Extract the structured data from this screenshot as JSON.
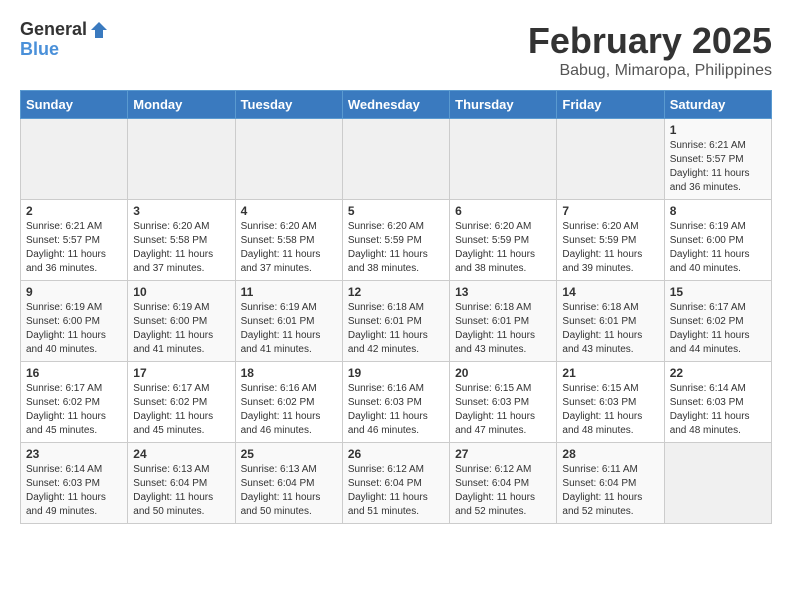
{
  "logo": {
    "general": "General",
    "blue": "Blue"
  },
  "title": "February 2025",
  "subtitle": "Babug, Mimaropa, Philippines",
  "days_of_week": [
    "Sunday",
    "Monday",
    "Tuesday",
    "Wednesday",
    "Thursday",
    "Friday",
    "Saturday"
  ],
  "weeks": [
    [
      {
        "day": "",
        "sunrise": "",
        "sunset": "",
        "daylight": ""
      },
      {
        "day": "",
        "sunrise": "",
        "sunset": "",
        "daylight": ""
      },
      {
        "day": "",
        "sunrise": "",
        "sunset": "",
        "daylight": ""
      },
      {
        "day": "",
        "sunrise": "",
        "sunset": "",
        "daylight": ""
      },
      {
        "day": "",
        "sunrise": "",
        "sunset": "",
        "daylight": ""
      },
      {
        "day": "",
        "sunrise": "",
        "sunset": "",
        "daylight": ""
      },
      {
        "day": "1",
        "sunrise": "Sunrise: 6:21 AM",
        "sunset": "Sunset: 5:57 PM",
        "daylight": "Daylight: 11 hours and 36 minutes."
      }
    ],
    [
      {
        "day": "2",
        "sunrise": "Sunrise: 6:21 AM",
        "sunset": "Sunset: 5:57 PM",
        "daylight": "Daylight: 11 hours and 36 minutes."
      },
      {
        "day": "3",
        "sunrise": "Sunrise: 6:20 AM",
        "sunset": "Sunset: 5:58 PM",
        "daylight": "Daylight: 11 hours and 37 minutes."
      },
      {
        "day": "4",
        "sunrise": "Sunrise: 6:20 AM",
        "sunset": "Sunset: 5:58 PM",
        "daylight": "Daylight: 11 hours and 37 minutes."
      },
      {
        "day": "5",
        "sunrise": "Sunrise: 6:20 AM",
        "sunset": "Sunset: 5:59 PM",
        "daylight": "Daylight: 11 hours and 38 minutes."
      },
      {
        "day": "6",
        "sunrise": "Sunrise: 6:20 AM",
        "sunset": "Sunset: 5:59 PM",
        "daylight": "Daylight: 11 hours and 38 minutes."
      },
      {
        "day": "7",
        "sunrise": "Sunrise: 6:20 AM",
        "sunset": "Sunset: 5:59 PM",
        "daylight": "Daylight: 11 hours and 39 minutes."
      },
      {
        "day": "8",
        "sunrise": "Sunrise: 6:19 AM",
        "sunset": "Sunset: 6:00 PM",
        "daylight": "Daylight: 11 hours and 40 minutes."
      }
    ],
    [
      {
        "day": "9",
        "sunrise": "Sunrise: 6:19 AM",
        "sunset": "Sunset: 6:00 PM",
        "daylight": "Daylight: 11 hours and 40 minutes."
      },
      {
        "day": "10",
        "sunrise": "Sunrise: 6:19 AM",
        "sunset": "Sunset: 6:00 PM",
        "daylight": "Daylight: 11 hours and 41 minutes."
      },
      {
        "day": "11",
        "sunrise": "Sunrise: 6:19 AM",
        "sunset": "Sunset: 6:01 PM",
        "daylight": "Daylight: 11 hours and 41 minutes."
      },
      {
        "day": "12",
        "sunrise": "Sunrise: 6:18 AM",
        "sunset": "Sunset: 6:01 PM",
        "daylight": "Daylight: 11 hours and 42 minutes."
      },
      {
        "day": "13",
        "sunrise": "Sunrise: 6:18 AM",
        "sunset": "Sunset: 6:01 PM",
        "daylight": "Daylight: 11 hours and 43 minutes."
      },
      {
        "day": "14",
        "sunrise": "Sunrise: 6:18 AM",
        "sunset": "Sunset: 6:01 PM",
        "daylight": "Daylight: 11 hours and 43 minutes."
      },
      {
        "day": "15",
        "sunrise": "Sunrise: 6:17 AM",
        "sunset": "Sunset: 6:02 PM",
        "daylight": "Daylight: 11 hours and 44 minutes."
      }
    ],
    [
      {
        "day": "16",
        "sunrise": "Sunrise: 6:17 AM",
        "sunset": "Sunset: 6:02 PM",
        "daylight": "Daylight: 11 hours and 45 minutes."
      },
      {
        "day": "17",
        "sunrise": "Sunrise: 6:17 AM",
        "sunset": "Sunset: 6:02 PM",
        "daylight": "Daylight: 11 hours and 45 minutes."
      },
      {
        "day": "18",
        "sunrise": "Sunrise: 6:16 AM",
        "sunset": "Sunset: 6:02 PM",
        "daylight": "Daylight: 11 hours and 46 minutes."
      },
      {
        "day": "19",
        "sunrise": "Sunrise: 6:16 AM",
        "sunset": "Sunset: 6:03 PM",
        "daylight": "Daylight: 11 hours and 46 minutes."
      },
      {
        "day": "20",
        "sunrise": "Sunrise: 6:15 AM",
        "sunset": "Sunset: 6:03 PM",
        "daylight": "Daylight: 11 hours and 47 minutes."
      },
      {
        "day": "21",
        "sunrise": "Sunrise: 6:15 AM",
        "sunset": "Sunset: 6:03 PM",
        "daylight": "Daylight: 11 hours and 48 minutes."
      },
      {
        "day": "22",
        "sunrise": "Sunrise: 6:14 AM",
        "sunset": "Sunset: 6:03 PM",
        "daylight": "Daylight: 11 hours and 48 minutes."
      }
    ],
    [
      {
        "day": "23",
        "sunrise": "Sunrise: 6:14 AM",
        "sunset": "Sunset: 6:03 PM",
        "daylight": "Daylight: 11 hours and 49 minutes."
      },
      {
        "day": "24",
        "sunrise": "Sunrise: 6:13 AM",
        "sunset": "Sunset: 6:04 PM",
        "daylight": "Daylight: 11 hours and 50 minutes."
      },
      {
        "day": "25",
        "sunrise": "Sunrise: 6:13 AM",
        "sunset": "Sunset: 6:04 PM",
        "daylight": "Daylight: 11 hours and 50 minutes."
      },
      {
        "day": "26",
        "sunrise": "Sunrise: 6:12 AM",
        "sunset": "Sunset: 6:04 PM",
        "daylight": "Daylight: 11 hours and 51 minutes."
      },
      {
        "day": "27",
        "sunrise": "Sunrise: 6:12 AM",
        "sunset": "Sunset: 6:04 PM",
        "daylight": "Daylight: 11 hours and 52 minutes."
      },
      {
        "day": "28",
        "sunrise": "Sunrise: 6:11 AM",
        "sunset": "Sunset: 6:04 PM",
        "daylight": "Daylight: 11 hours and 52 minutes."
      },
      {
        "day": "",
        "sunrise": "",
        "sunset": "",
        "daylight": ""
      }
    ]
  ]
}
